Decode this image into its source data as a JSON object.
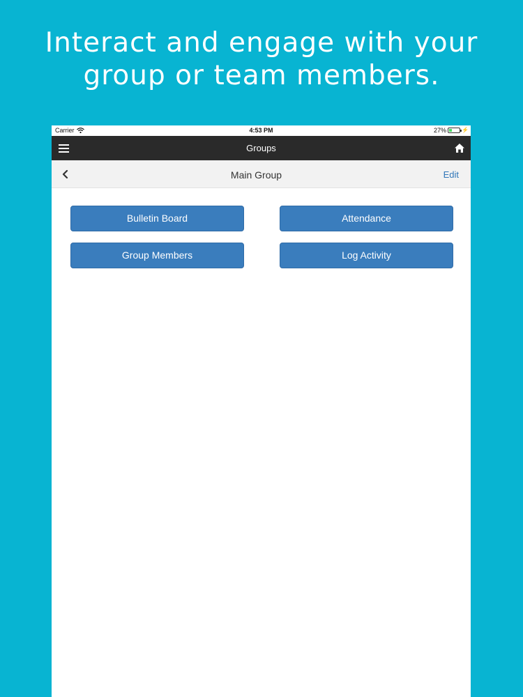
{
  "headline": {
    "line1": "Interact and engage with your",
    "line2": "group or team members."
  },
  "status_bar": {
    "carrier": "Carrier",
    "time": "4:53 PM",
    "battery": "27%",
    "battery_level": 0.27
  },
  "nav": {
    "title": "Groups",
    "menu_icon": "hamburger-menu-icon",
    "home_icon": "home-icon"
  },
  "sub_header": {
    "title": "Main Group",
    "edit_label": "Edit",
    "back_icon": "chevron-left-icon"
  },
  "buttons": [
    {
      "label": "Bulletin Board"
    },
    {
      "label": "Attendance"
    },
    {
      "label": "Group Members"
    },
    {
      "label": "Log Activity"
    }
  ],
  "colors": {
    "background": "#08b4d2",
    "nav_bar": "#2a2a2a",
    "button": "#3a7dbd",
    "link": "#2f76b8"
  }
}
